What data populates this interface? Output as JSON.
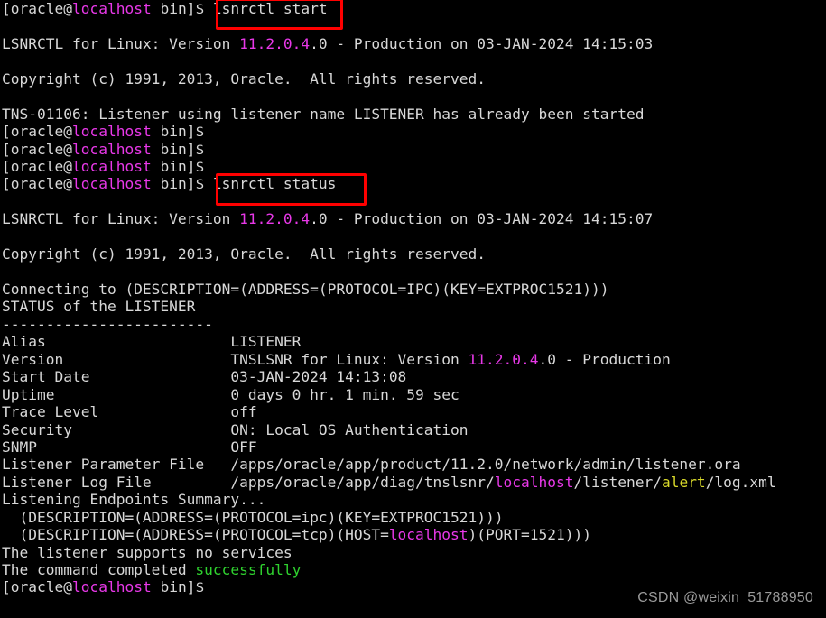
{
  "terminal": {
    "title": "oracle@localhost terminal - lsnrctl",
    "colors": {
      "background": "#000000",
      "foreground": "#d8d8d8",
      "magenta": "#e838e8",
      "green": "#2fd22f",
      "yellow": "#d8d82a",
      "highlight_box": "#ff0000"
    },
    "prompt": {
      "bracket_open": "[",
      "user": "oracle",
      "at": "@",
      "host": "localhost",
      "space_dir": " bin]$ ",
      "full": "[oracle@localhost bin]$ "
    },
    "commands": {
      "first": "lsnrctl start",
      "second": "lsnrctl status"
    },
    "lines": [
      {
        "id": "prompt-cmd-start",
        "type": "prompt",
        "command": "lsnrctl start"
      },
      {
        "id": "blank-1",
        "type": "blank"
      },
      {
        "id": "banner-1",
        "type": "banner",
        "pre": "LSNRCTL for Linux: Version ",
        "version": "11.2.0.4",
        "post": ".0 - Production on 03-JAN-2024 14:15:03"
      },
      {
        "id": "blank-2",
        "type": "blank"
      },
      {
        "id": "copyright-1",
        "type": "plain",
        "text": "Copyright (c) 1991, 2013, Oracle.  All rights reserved."
      },
      {
        "id": "blank-3",
        "type": "blank"
      },
      {
        "id": "tns-error",
        "type": "plain",
        "text": "TNS-01106: Listener using listener name LISTENER has already been started"
      },
      {
        "id": "prompt-2",
        "type": "prompt",
        "command": ""
      },
      {
        "id": "prompt-3",
        "type": "prompt",
        "command": ""
      },
      {
        "id": "prompt-4",
        "type": "prompt",
        "command": ""
      },
      {
        "id": "prompt-cmd-status",
        "type": "prompt",
        "command": "lsnrctl status"
      },
      {
        "id": "blank-4",
        "type": "blank"
      },
      {
        "id": "banner-2",
        "type": "banner",
        "pre": "LSNRCTL for Linux: Version ",
        "version": "11.2.0.4",
        "post": ".0 - Production on 03-JAN-2024 14:15:07"
      },
      {
        "id": "blank-5",
        "type": "blank"
      },
      {
        "id": "copyright-2",
        "type": "plain",
        "text": "Copyright (c) 1991, 2013, Oracle.  All rights reserved."
      },
      {
        "id": "blank-6",
        "type": "blank"
      },
      {
        "id": "connecting",
        "type": "plain",
        "text": "Connecting to (DESCRIPTION=(ADDRESS=(PROTOCOL=IPC)(KEY=EXTPROC1521)))"
      },
      {
        "id": "status-header",
        "type": "plain",
        "text": "STATUS of the LISTENER"
      },
      {
        "id": "divider",
        "type": "plain",
        "text": "------------------------"
      }
    ],
    "status_table": [
      {
        "label": "Alias",
        "value": "LISTENER"
      },
      {
        "label": "Version",
        "value_pre": "TNSLSNR for Linux: Version ",
        "value_version": "11.2.0.4",
        "value_post": ".0 - Production"
      },
      {
        "label": "Start Date",
        "value": "03-JAN-2024 14:13:08"
      },
      {
        "label": "Uptime",
        "value": "0 days 0 hr. 1 min. 59 sec"
      },
      {
        "label": "Trace Level",
        "value": "off"
      },
      {
        "label": "Security",
        "value": "ON: Local OS Authentication"
      },
      {
        "label": "SNMP",
        "value": "OFF"
      },
      {
        "label": "Listener Parameter File",
        "value": "/apps/oracle/app/product/11.2.0/network/admin/listener.ora"
      },
      {
        "label": "Listener Log File",
        "value_pre": "/apps/oracle/app/diag/tnslsnr/",
        "value_host": "localhost",
        "value_mid": "/listener/",
        "value_alert": "alert",
        "value_post": "/log.xml"
      }
    ],
    "endpoints": {
      "summary_label": "Listening Endpoints Summary...",
      "ipc": "  (DESCRIPTION=(ADDRESS=(PROTOCOL=ipc)(KEY=EXTPROC1521)))",
      "tcp_pre": "  (DESCRIPTION=(ADDRESS=(PROTOCOL=tcp)(HOST=",
      "tcp_host": "localhost",
      "tcp_post": ")(PORT=1521)))"
    },
    "footer": {
      "services": "The listener supports no services",
      "completed_pre": "The command completed ",
      "completed_status": "successfully",
      "final_prompt_command": ""
    },
    "watermark": "CSDN @weixin_51788950"
  }
}
